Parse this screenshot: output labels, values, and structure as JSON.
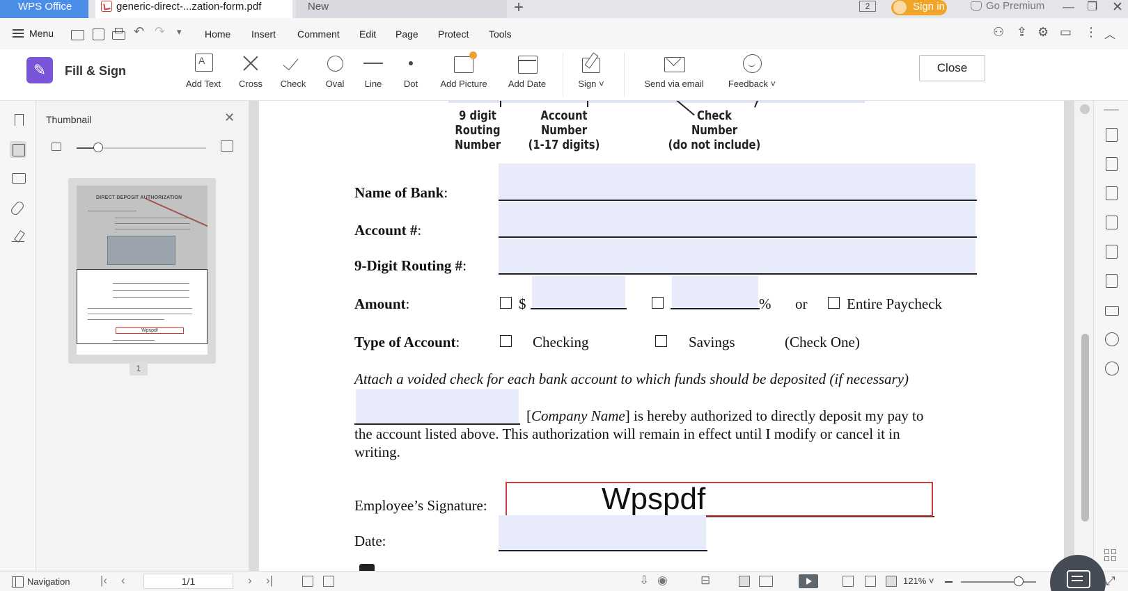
{
  "titlebar": {
    "app_tab": "WPS Office",
    "doc_tab": "generic-direct-...zation-form.pdf",
    "new_tab": "New",
    "window_count": "2",
    "sign_in": "Sign in",
    "premium": "Go Premium"
  },
  "menubar": {
    "menu": "Menu",
    "items": [
      "Home",
      "Insert",
      "Comment",
      "Edit",
      "Page",
      "Protect",
      "Tools"
    ]
  },
  "toolbar": {
    "mode_title": "Fill & Sign",
    "tools": [
      "Add Text",
      "Cross",
      "Check",
      "Oval",
      "Line",
      "Dot",
      "Add Picture",
      "Add Date",
      "Sign ˅",
      "Send via email",
      "Feedback ˅"
    ],
    "close": "Close"
  },
  "thumbnail_panel": {
    "title": "Thumbnail",
    "preview_heading": "DIRECT DEPOSIT AUTHORIZATION",
    "preview_signature": "Wpspdf",
    "page_number": "1"
  },
  "document": {
    "cheque_labels": {
      "routing": "9 digit\nRouting\nNumber",
      "account": "Account\nNumber\n(1-17 digits)",
      "check": "Check\nNumber\n(do not include)"
    },
    "name_of_bank": "Name of Bank",
    "account": "Account #",
    "routing": "9-Digit Routing #",
    "colon": ":",
    "amount": "Amount",
    "dollar": "$",
    "percent": "%",
    "or": "or",
    "entire_paycheck": "Entire Paycheck",
    "type_of_account": "Type of Account",
    "checking": "Checking",
    "savings": "Savings",
    "check_one": "(Check One)",
    "attach_note": "Attach a voided check for each bank account to which funds should be deposited (if necessary)",
    "company_name": "Company Name",
    "auth_line1_end": "is hereby authorized to directly deposit my pay to",
    "auth_line2": "the account listed above. This authorization will remain in effect until I modify or cancel it in",
    "auth_line3": "writing.",
    "employee_signature": "Employee’s Signature:",
    "signature_value": "Wpspdf",
    "date": "Date:"
  },
  "statusbar": {
    "navigation": "Navigation",
    "page_input": "1/1",
    "zoom": "121% ˅"
  },
  "colors": {
    "accent": "#4a8ee8",
    "sign_in_orange": "#f0a52a",
    "fill_sign_purple": "#7b55d8",
    "form_field": "#e8ecfa",
    "signature_border": "#d03a3a"
  }
}
